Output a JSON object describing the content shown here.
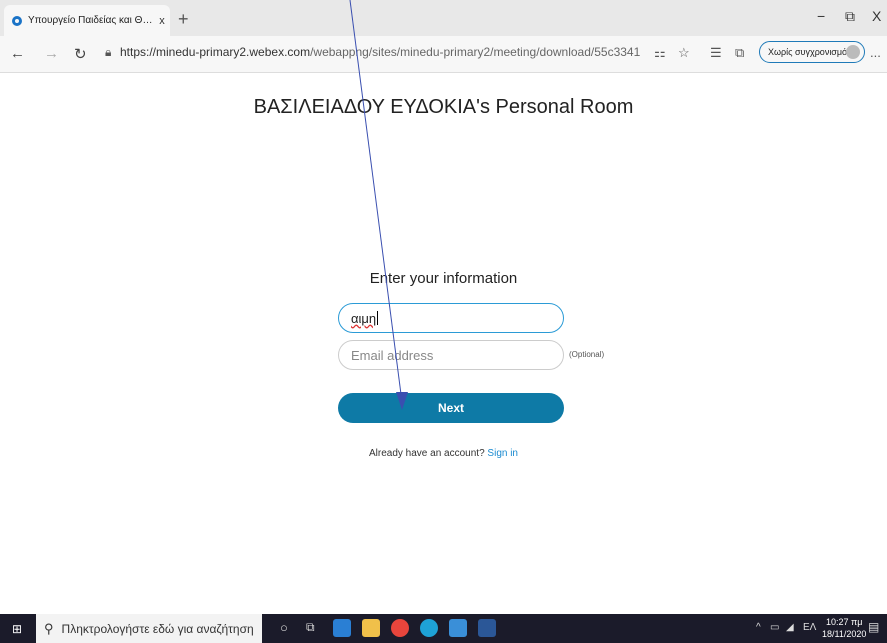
{
  "browser": {
    "tab_title": "Υπουργείο Παιδείας και Θρησκε",
    "tab_close": "x",
    "new_tab": "+",
    "minimize": "−",
    "restore": "⧉",
    "close": "X",
    "url_host": "https://minedu-primary2.webex.com",
    "url_path": "/webappng/sites/minedu-primary2/meeting/download/55c33416dc51b3...",
    "profile_label": "Χωρίς συγχρονισμό",
    "menu": "..."
  },
  "page": {
    "title": "ΒΑΣΙΛΕΙΑΔΟΥ ΕΥΔΟΚΙΑ's Personal Room",
    "form_heading": "Enter your information",
    "name_value": "αιμη",
    "email_placeholder": "Email address",
    "optional_label": "(Optional)",
    "next_label": "Next",
    "account_prompt": "Already have an account?",
    "sign_in_label": "Sign in"
  },
  "taskbar": {
    "search_placeholder": "Πληκτρολογήστε εδώ για αναζήτηση",
    "tray_lang": "ΕΛ",
    "time": "10:27 πμ",
    "date": "18/11/2020"
  },
  "colors": {
    "accent": "#0e7aa6",
    "link": "#1a8ad0",
    "taskbar": "#1b1b2a",
    "annotation_arrow": "#3a4fb0"
  }
}
